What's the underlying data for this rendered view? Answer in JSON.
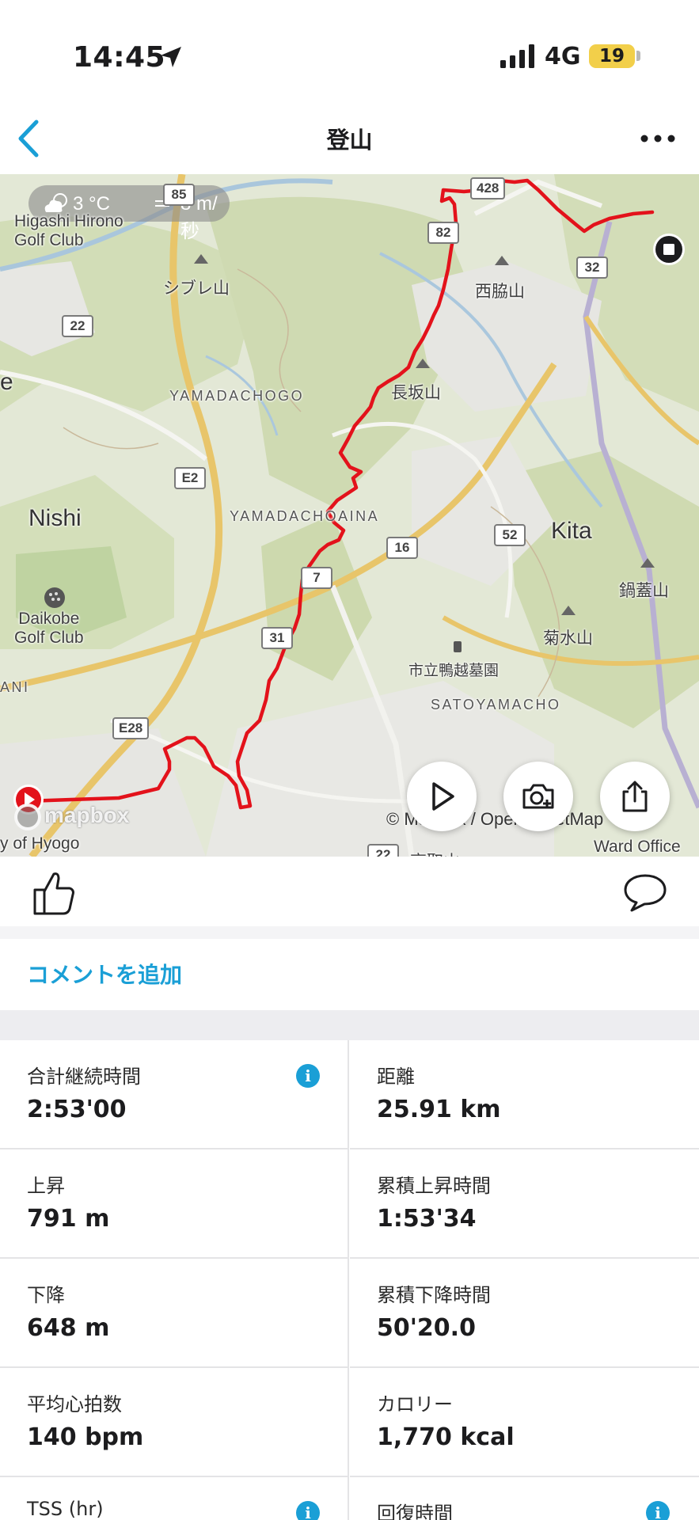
{
  "status_bar": {
    "time": "14:45",
    "network": "4G",
    "battery": "19"
  },
  "nav": {
    "title": "登山"
  },
  "map": {
    "weather": {
      "temperature": "3 °C",
      "wind": "8 m/秒"
    },
    "labels": {
      "higashi_hirono": "Higashi Hirono\nGolf Club",
      "shibure": "シブレ山",
      "yamadachogo": "YAMADACHOGO",
      "nagasaka": "長坂山",
      "nishiwaki": "西脇山",
      "nishi": "Nishi",
      "yamadachoaina": "YAMADACHOAINA",
      "kita": "Kita",
      "nabebuta": "鍋蓋山",
      "kikusui": "菊水山",
      "daikobe": "Daikobe\nGolf Club",
      "kamogoe": "市立鴨越墓園",
      "satoyamacho": "SATOYAMACHO",
      "edge_e": "e",
      "edge_ani": "ANI",
      "hyogo": "y of Hyogo",
      "ward_office": "Ward Office",
      "bottom_partial": "高取山"
    },
    "shields": [
      "428",
      "85",
      "82",
      "32",
      "22",
      "E2",
      "16",
      "52",
      "7",
      "31",
      "E28",
      "22"
    ],
    "attribution": "© Mapbox / OpenStreetMap",
    "mapbox_logo": "mapbox"
  },
  "actions": {
    "add_comment": "コメントを追加"
  },
  "stats": [
    {
      "label": "合計継続時間",
      "value": "2:53'00",
      "info": true
    },
    {
      "label": "距離",
      "value": "25.91 km",
      "info": false
    },
    {
      "label": "上昇",
      "value": "791 m",
      "info": false
    },
    {
      "label": "累積上昇時間",
      "value": "1:53'34",
      "info": false
    },
    {
      "label": "下降",
      "value": "648 m",
      "info": false
    },
    {
      "label": "累積下降時間",
      "value": "50'20.0",
      "info": false
    },
    {
      "label": "平均心拍数",
      "value": "140 bpm",
      "info": false
    },
    {
      "label": "カロリー",
      "value": "1,770 kcal",
      "info": false
    },
    {
      "label": "TSS (hr)",
      "value": "",
      "info": true
    },
    {
      "label": "回復時間",
      "value": "",
      "info": true
    }
  ],
  "colors": {
    "accent": "#1a9fd6",
    "route": "#e3121b",
    "battery": "#f2cf4a"
  }
}
